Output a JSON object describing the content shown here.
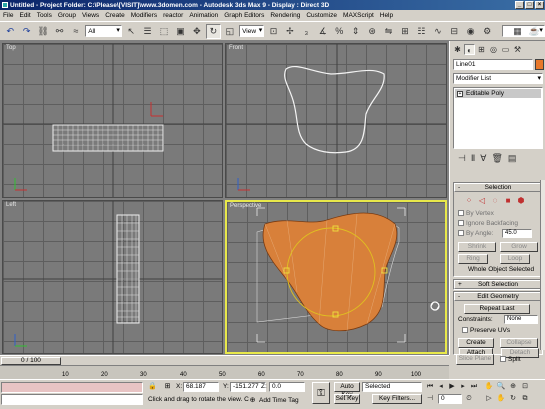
{
  "window": {
    "title": "Untitled   - Project Folder: C:\\Please\\[VISIT]\\www.3domen.com   - Autodesk 3ds Max 9    - Display : Direct 3D",
    "btn_min": "_",
    "btn_max": "□",
    "btn_close": "×"
  },
  "menu": [
    "File",
    "Edit",
    "Tools",
    "Group",
    "Views",
    "Create",
    "Modifiers",
    "reactor",
    "Animation",
    "Graph Editors",
    "Rendering",
    "Customize",
    "MAXScript",
    "Help"
  ],
  "toolbar": {
    "selection_filter": "All",
    "ref_coord": "View"
  },
  "viewports": {
    "top": "Top",
    "front": "Front",
    "left": "Left",
    "perspective": "Perspective"
  },
  "command_panel": {
    "object_name": "Line01",
    "object_color": "#e8782a",
    "modifier_list": "Modifier List",
    "stack_item": "Editable Poly",
    "selection": {
      "header": "Selection",
      "by_vertex": "By Vertex",
      "ignore_backfacing": "Ignore Backfacing",
      "by_angle": "By Angle:",
      "angle_value": "45.0",
      "shrink": "Shrink",
      "grow": "Grow",
      "ring": "Ring",
      "loop": "Loop",
      "status": "Whole Object Selected"
    },
    "soft_selection": {
      "header": "Soft Selection"
    },
    "edit_geometry": {
      "header": "Edit Geometry",
      "repeat_last": "Repeat Last",
      "constraints": "Constraints:",
      "constraints_value": "None",
      "preserve_uvs": "Preserve UVs",
      "create": "Create",
      "collapse": "Collapse",
      "attach": "Attach",
      "detach": "Detach",
      "slice_plane": "Slice Plane",
      "split": "Split"
    }
  },
  "timeline": {
    "slider": "0 / 100",
    "ticks": [
      "10",
      "20",
      "30",
      "40",
      "50",
      "60",
      "70",
      "80",
      "90",
      "100"
    ]
  },
  "status": {
    "x_label": "X:",
    "x_value": "68.187",
    "y_label": "Y:",
    "y_value": "-151.277",
    "z_label": "Z:",
    "z_value": "0.0",
    "prompt": "Click and drag to rotate the view. C",
    "add_time_tag": "Add Time Tag",
    "auto_key": "Auto Key",
    "set_key": "Set Key",
    "selected": "Selected",
    "key_filters": "Key Filters...",
    "frame": "0"
  }
}
